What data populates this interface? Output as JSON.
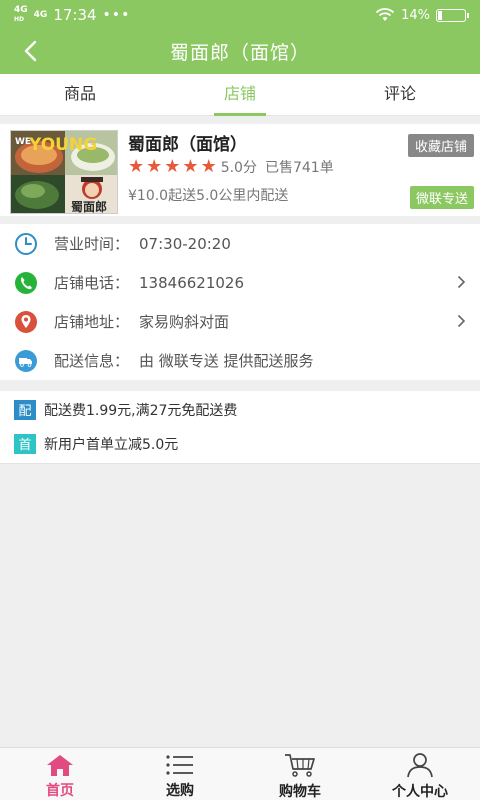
{
  "status_bar": {
    "network_1": "4G",
    "network_1_sub": "HD",
    "network_2": "4G",
    "time": "17:34",
    "dots": "•••",
    "battery_percent": "14%",
    "battery_level": 0.14
  },
  "header": {
    "title": "蜀面郎（面馆）"
  },
  "tabs": [
    {
      "label": "商品",
      "active": false
    },
    {
      "label": "店铺",
      "active": true
    },
    {
      "label": "评论",
      "active": false
    }
  ],
  "shop": {
    "name": "蜀面郎（面馆）",
    "rating_stars": 5,
    "score": "5.0分",
    "sold": "已售741单",
    "delivery_info": "¥10.0起送5.0公里内配送",
    "favorite_label": "收藏店铺",
    "delivery_badge": "微联专送",
    "image_text_top": "YOUNG",
    "image_text_bottom": "蜀面郎"
  },
  "info": {
    "hours_label": "营业时间：",
    "hours_value": "07:30-20:20",
    "phone_label": "店铺电话：",
    "phone_value": "13846621026",
    "address_label": "店铺地址：",
    "address_value": "家易购斜对面",
    "delivery_label": "配送信息：",
    "delivery_value": "由 微联专送 提供配送服务"
  },
  "promos": [
    {
      "tag": "配",
      "tag_color": "#2d8ec7",
      "text": "配送费1.99元,满27元免配送费"
    },
    {
      "tag": "首",
      "tag_color": "#2ec3c4",
      "text": "新用户首单立减5.0元"
    }
  ],
  "bottom_nav": [
    {
      "label": "首页",
      "icon": "home-icon",
      "active": true
    },
    {
      "label": "选购",
      "icon": "list-icon",
      "active": false
    },
    {
      "label": "购物车",
      "icon": "cart-icon",
      "active": false
    },
    {
      "label": "个人中心",
      "icon": "person-icon",
      "active": false
    }
  ],
  "colors": {
    "brand_green": "#8cc862",
    "active_pink": "#e24b82",
    "star_red": "#e65a3c"
  }
}
